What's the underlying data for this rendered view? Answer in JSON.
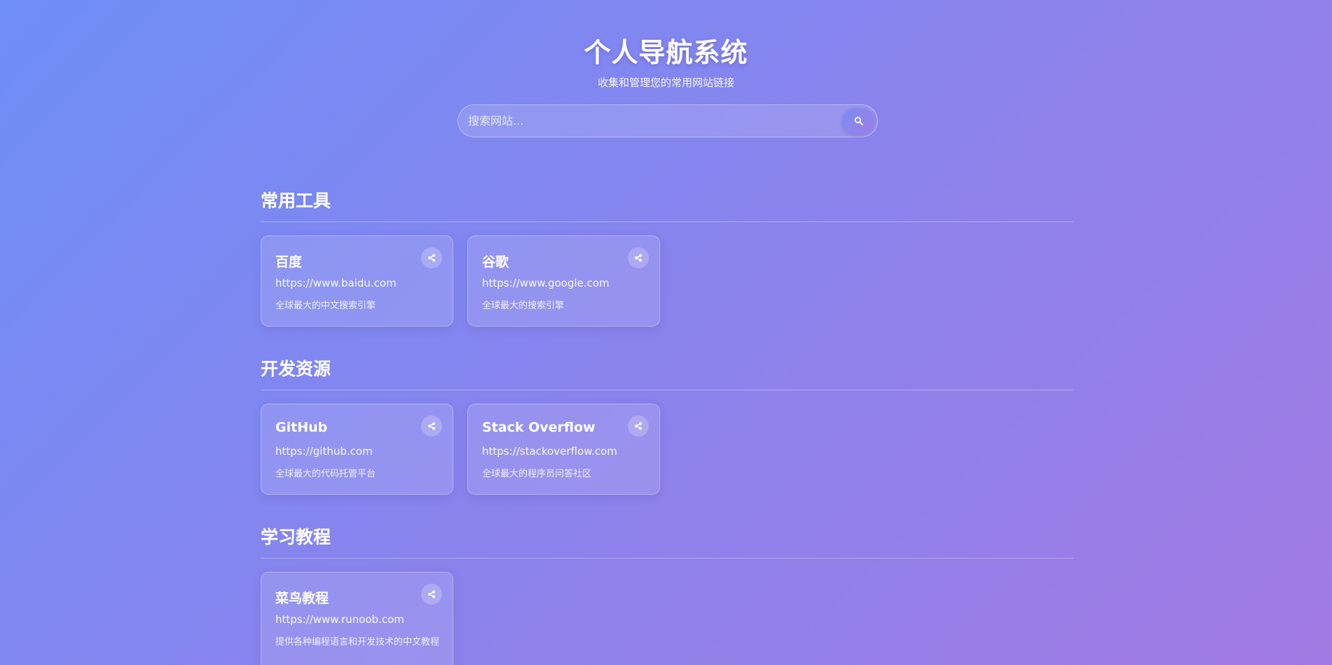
{
  "header": {
    "title": "个人导航系统",
    "subtitle": "收集和管理您的常用网站链接"
  },
  "search": {
    "placeholder": "搜索网站...",
    "button_icon": "search-icon"
  },
  "categories": [
    {
      "title": "常用工具",
      "sites": [
        {
          "name": "百度",
          "url": "https://www.baidu.com",
          "description": "全球最大的中文搜索引擎",
          "action_icon": "share-icon"
        },
        {
          "name": "谷歌",
          "url": "https://www.google.com",
          "description": "全球最大的搜索引擎",
          "action_icon": "share-icon"
        }
      ]
    },
    {
      "title": "开发资源",
      "sites": [
        {
          "name": "GitHub",
          "url": "https://github.com",
          "description": "全球最大的代码托管平台",
          "action_icon": "share-icon"
        },
        {
          "name": "Stack Overflow",
          "url": "https://stackoverflow.com",
          "description": "全球最大的程序员问答社区",
          "action_icon": "share-icon"
        }
      ]
    },
    {
      "title": "学习教程",
      "sites": [
        {
          "name": "菜鸟教程",
          "url": "https://www.runoob.com",
          "description": "提供各种编程语言和开发技术的中文教程",
          "action_icon": "share-icon"
        }
      ]
    }
  ],
  "colors": {
    "background_start": "#6e8ef8",
    "background_end": "#a27ae4",
    "text": "#ffffff"
  }
}
